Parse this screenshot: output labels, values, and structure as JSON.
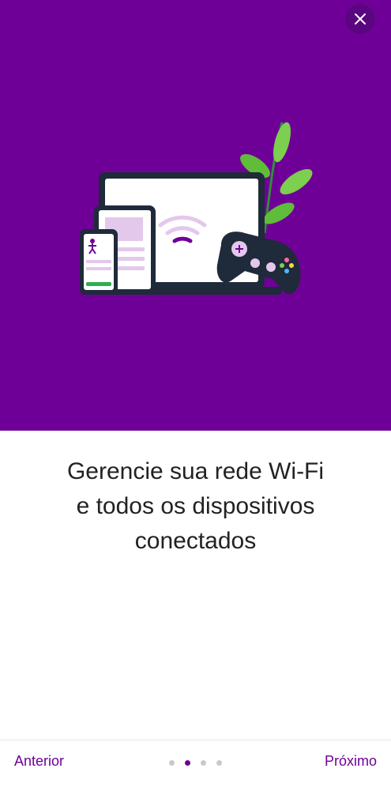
{
  "close_button": {
    "icon": "close-icon"
  },
  "headline": {
    "line1": "Gerencie sua rede Wi-Fi",
    "line2": "e todos os dispositivos",
    "line3": "conectados"
  },
  "footer": {
    "prev_label": "Anterior",
    "next_label": "Próximo",
    "pagination": {
      "total": 4,
      "current": 2
    }
  },
  "colors": {
    "brand": "#6f0097",
    "hero_background": "#6f0097",
    "text": "#222222"
  }
}
